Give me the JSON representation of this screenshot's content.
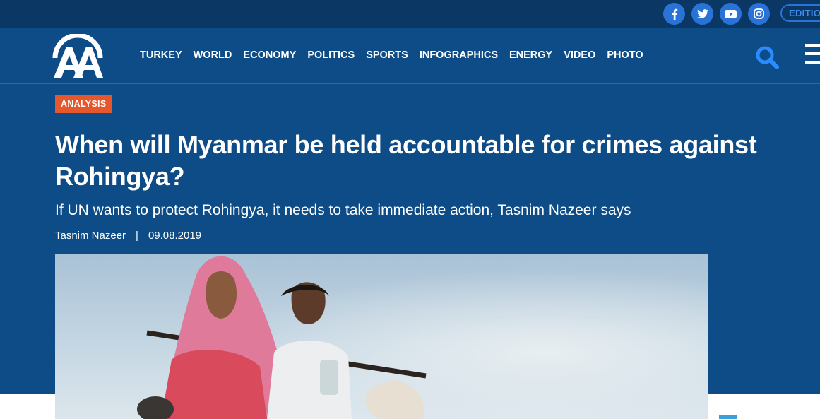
{
  "topbar": {
    "social": [
      {
        "name": "facebook-icon"
      },
      {
        "name": "twitter-icon"
      },
      {
        "name": "youtube-icon"
      },
      {
        "name": "instagram-icon"
      }
    ],
    "edition_label": "EDITION"
  },
  "nav": {
    "logo_name": "AA logo",
    "items": [
      "TURKEY",
      "WORLD",
      "ECONOMY",
      "POLITICS",
      "SPORTS",
      "INFOGRAPHICS",
      "ENERGY",
      "VIDEO",
      "PHOTO"
    ],
    "search_icon": "search-icon",
    "menu_icon": "hamburger-menu-icon"
  },
  "article": {
    "category": "ANALYSIS",
    "title": "When will Myanmar be held accountable for crimes against Rohingya?",
    "subtitle": "If UN wants to protect Rohingya, it needs to take immediate action, Tasnim Nazeer says",
    "author": "Tasnim Nazeer",
    "separator": "|",
    "date": "09.08.2019"
  },
  "colors": {
    "topbar": "#0a3764",
    "navbar": "#0d4c86",
    "badge": "#e6572b",
    "social": "#2a73d6"
  }
}
